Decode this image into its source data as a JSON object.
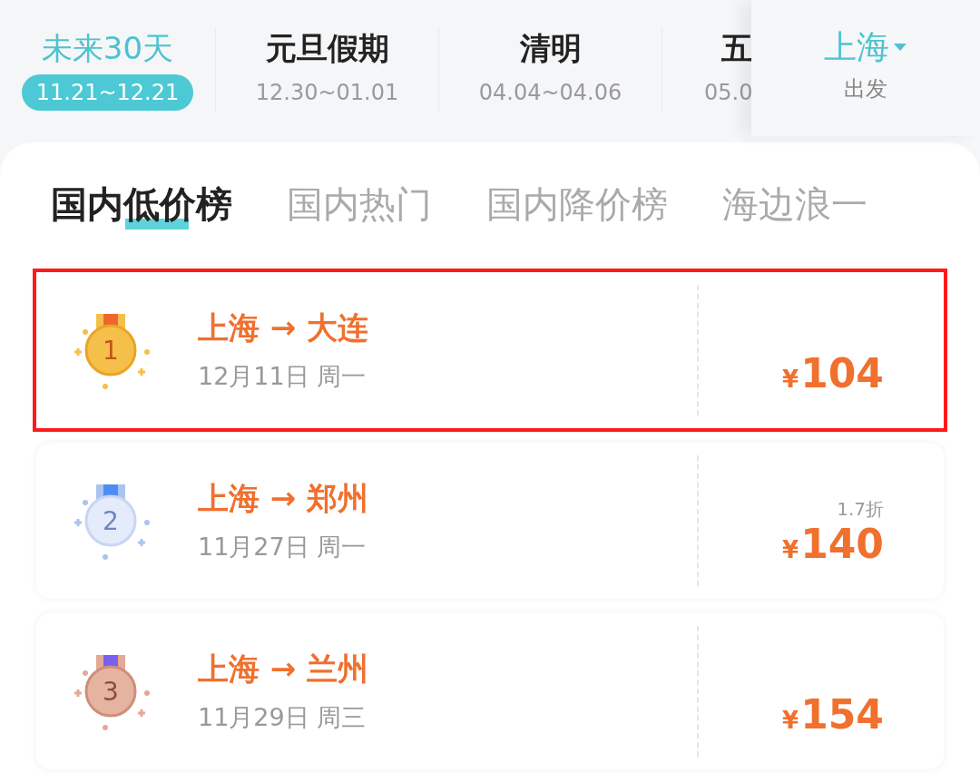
{
  "date_tabs": [
    {
      "title": "未来30天",
      "dates": "11.21~12.21",
      "selected": true
    },
    {
      "title": "元旦假期",
      "dates": "12.30~01.01",
      "selected": false
    },
    {
      "title": "清明",
      "dates": "04.04~04.06",
      "selected": false
    },
    {
      "title": "五",
      "dates": "05.0",
      "selected": false
    }
  ],
  "departure": {
    "city": "上海",
    "label": "出发"
  },
  "ranking_tabs": [
    {
      "label": "国内低价榜",
      "selected": true
    },
    {
      "label": "国内热门",
      "selected": false
    },
    {
      "label": "国内降价榜",
      "selected": false
    },
    {
      "label": "海边浪一",
      "selected": false
    }
  ],
  "deals": [
    {
      "rank": "1",
      "kind": "gold",
      "route": "上海 → 大连",
      "date": "12月11日 周一",
      "currency": "¥",
      "price": "104",
      "highlighted": true
    },
    {
      "rank": "2",
      "kind": "silver",
      "route": "上海 → 郑州",
      "date": "11月27日 周一",
      "discount": "1.7折",
      "currency": "¥",
      "price": "140",
      "highlighted": false
    },
    {
      "rank": "3",
      "kind": "bronze",
      "route": "上海 → 兰州",
      "date": "11月29日 周三",
      "currency": "¥",
      "price": "154",
      "highlighted": false
    }
  ]
}
